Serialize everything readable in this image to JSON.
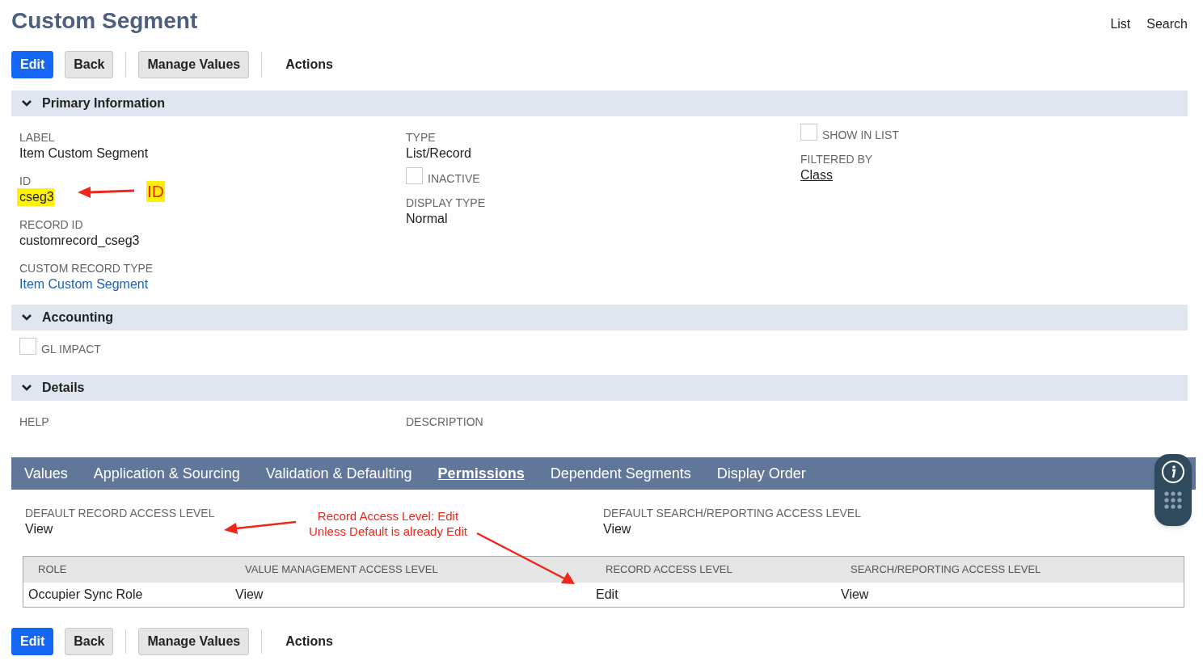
{
  "page_title": "Custom Segment",
  "header_links": [
    "List",
    "Search"
  ],
  "toolbar_top": {
    "buttons": [
      {
        "label": "Edit",
        "kind": "primary"
      },
      {
        "label": "Back",
        "kind": "secondary"
      },
      {
        "label": "Manage Values",
        "kind": "secondary"
      }
    ],
    "menu": "Actions"
  },
  "sections": [
    {
      "title": "Primary Information",
      "expanded": true,
      "columns": [
        [
          {
            "kind": "text",
            "label": "LABEL",
            "value": "Item Custom Segment"
          },
          {
            "kind": "text",
            "label": "ID",
            "value": "cseg3",
            "highlighted": true
          },
          {
            "kind": "text",
            "label": "RECORD ID",
            "value": "customrecord_cseg3"
          },
          {
            "kind": "link",
            "label": "CUSTOM RECORD TYPE",
            "value": "Item Custom Segment"
          }
        ],
        [
          {
            "kind": "text",
            "label": "TYPE",
            "value": "List/Record"
          },
          {
            "kind": "checkbox",
            "label": "INACTIVE",
            "checked": false
          },
          {
            "kind": "text",
            "label": "DISPLAY TYPE",
            "value": "Normal"
          }
        ],
        [
          {
            "kind": "checkbox",
            "label": "SHOW IN LIST",
            "checked": false
          },
          {
            "kind": "underlined",
            "label": "FILTERED BY",
            "value": "Class"
          }
        ]
      ]
    },
    {
      "title": "Accounting",
      "expanded": true,
      "columns": [
        [
          {
            "kind": "checkbox",
            "label": "GL IMPACT",
            "checked": false
          }
        ]
      ]
    },
    {
      "title": "Details",
      "expanded": true,
      "columns": [
        [
          {
            "kind": "label",
            "label": "HELP"
          }
        ],
        [
          {
            "kind": "label",
            "label": "DESCRIPTION"
          }
        ]
      ]
    }
  ],
  "subtabs": [
    {
      "label": "Values",
      "selected": false
    },
    {
      "label": "Application & Sourcing",
      "selected": false
    },
    {
      "label": "Validation & Defaulting",
      "selected": false
    },
    {
      "label": "Permissions",
      "selected": true
    },
    {
      "label": "Dependent Segments",
      "selected": false
    },
    {
      "label": "Display Order",
      "selected": false
    }
  ],
  "permissions": {
    "defaults": [
      {
        "label": "DEFAULT RECORD ACCESS LEVEL",
        "value": "View"
      },
      {
        "label": "DEFAULT SEARCH/REPORTING ACCESS LEVEL",
        "value": "View"
      }
    ],
    "table": {
      "columns": [
        "ROLE",
        "VALUE MANAGEMENT ACCESS LEVEL",
        "RECORD ACCESS LEVEL",
        "SEARCH/REPORTING ACCESS LEVEL"
      ],
      "rows": [
        [
          "Occupier Sync Role",
          "View",
          "Edit",
          "View"
        ]
      ]
    }
  },
  "toolbar_bottom": {
    "buttons": [
      {
        "label": "Edit",
        "kind": "primary"
      },
      {
        "label": "Back",
        "kind": "secondary"
      },
      {
        "label": "Manage Values",
        "kind": "secondary"
      }
    ],
    "menu": "Actions"
  },
  "annotations": {
    "id_note": "ID",
    "access_note": [
      "Record Access Level: Edit",
      "Unless Default is already Edit"
    ]
  }
}
